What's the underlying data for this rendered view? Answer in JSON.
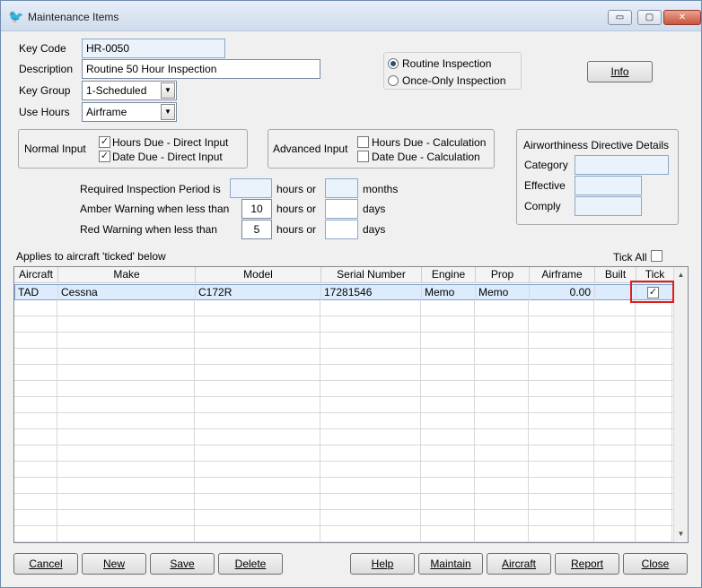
{
  "window": {
    "title": "Maintenance Items",
    "controls": {
      "minimize": "▭",
      "maximize": "▢",
      "close": "✕"
    }
  },
  "form": {
    "key_code": {
      "label": "Key Code",
      "value": "HR-0050"
    },
    "description": {
      "label": "Description",
      "value": "Routine 50 Hour Inspection"
    },
    "key_group": {
      "label": "Key Group",
      "value": "1-Scheduled"
    },
    "use_hours": {
      "label": "Use Hours",
      "value": "Airframe"
    },
    "inspection_type": {
      "options": [
        "Routine Inspection",
        "Once-Only Inspection"
      ],
      "selected": "Routine Inspection"
    },
    "info_button": "Info"
  },
  "normal_input": {
    "title": "Normal Input",
    "hours_due": {
      "label": "Hours Due - Direct Input",
      "checked": true
    },
    "date_due": {
      "label": "Date Due - Direct Input",
      "checked": true
    }
  },
  "advanced_input": {
    "title": "Advanced Input",
    "hours_due": {
      "label": "Hours Due - Calculation",
      "checked": false
    },
    "date_due": {
      "label": "Date Due - Calculation",
      "checked": false
    }
  },
  "ad_details": {
    "title": "Airworthiness Directive Details",
    "category_label": "Category",
    "effective_label": "Effective",
    "comply_label": "Comply",
    "category": "",
    "effective": "",
    "comply": ""
  },
  "periods": {
    "required": {
      "label": "Required Inspection Period is",
      "hours": "",
      "hours_unit": "hours or",
      "other": "",
      "other_unit": "months"
    },
    "amber": {
      "label": "Amber Warning when less than",
      "hours": "10",
      "hours_unit": "hours or",
      "other": "",
      "other_unit": "days"
    },
    "red": {
      "label": "Red Warning when less than",
      "hours": "5",
      "hours_unit": "hours or",
      "other": "",
      "other_unit": "days"
    }
  },
  "aircraft_list": {
    "caption": "Applies to aircraft 'ticked' below",
    "tick_all_label": "Tick All",
    "tick_all_checked": false,
    "columns": [
      "Aircraft",
      "Make",
      "Model",
      "Serial Number",
      "Engine",
      "Prop",
      "Airframe",
      "Built",
      "Tick"
    ],
    "rows": [
      {
        "aircraft": "TAD",
        "make": "Cessna",
        "model": "C172R",
        "serial": "17281546",
        "engine": "Memo",
        "prop": "Memo",
        "airframe": "0.00",
        "built": "",
        "tick": true
      }
    ]
  },
  "buttons": {
    "cancel": "Cancel",
    "new": "New",
    "save": "Save",
    "delete": "Delete",
    "help": "Help",
    "maintain": "Maintain",
    "aircraft": "Aircraft",
    "report": "Report",
    "close": "Close"
  },
  "icons": {
    "app": "bird-icon",
    "checkmark": "✓"
  }
}
